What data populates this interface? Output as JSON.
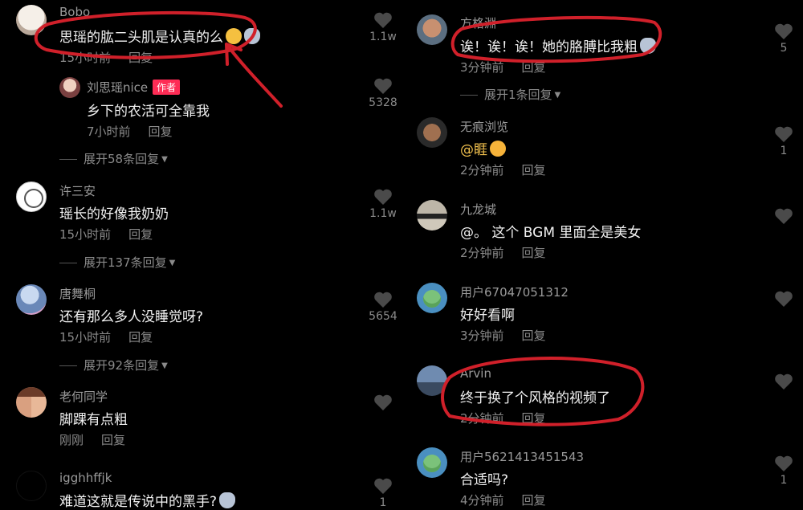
{
  "left": [
    {
      "name": "Bobo",
      "text": "思瑶的肱二头肌是认真的么",
      "time": "15小时前",
      "reply": "回复",
      "likes": "1.1w"
    },
    {
      "name": "刘思瑶nice",
      "tag": "作者",
      "text": "乡下的农活可全靠我",
      "time": "7小时前",
      "reply": "回复",
      "likes": "5328"
    },
    {
      "expand": "展开58条回复"
    },
    {
      "name": "许三安",
      "text": "瑶长的好像我奶奶",
      "time": "15小时前",
      "reply": "回复",
      "likes": "1.1w"
    },
    {
      "expand": "展开137条回复"
    },
    {
      "name": "唐舞桐",
      "text": "还有那么多人没睡觉呀?",
      "time": "15小时前",
      "reply": "回复",
      "likes": "5654"
    },
    {
      "expand": "展开92条回复"
    },
    {
      "name": "老何同学",
      "text": "脚踝有点粗",
      "time": "刚刚",
      "reply": "回复",
      "likes": ""
    },
    {
      "name": "igghhffjk",
      "text": "难道这就是传说中的黑手?",
      "time": "",
      "reply": "",
      "likes": "1"
    }
  ],
  "right": [
    {
      "name": "方格淵",
      "text": "诶！诶！诶！她的胳膊比我粗",
      "time": "3分钟前",
      "reply": "回复",
      "likes": "5"
    },
    {
      "expand": "展开1条回复"
    },
    {
      "name": "无痕浏览",
      "text": "@睚",
      "time": "2分钟前",
      "reply": "回复",
      "likes": "1"
    },
    {
      "name": "九龙城",
      "text": "@。 这个 BGM 里面全是美女",
      "time": "2分钟前",
      "reply": "回复",
      "likes": ""
    },
    {
      "name": "用户67047051312",
      "text": "好好看啊",
      "time": "3分钟前",
      "reply": "回复",
      "likes": ""
    },
    {
      "name": "Arvin",
      "text": "终于换了个风格的视频了",
      "time": "2分钟前",
      "reply": "回复",
      "likes": ""
    },
    {
      "name": "用户5621413451543",
      "text": "合适吗?",
      "time": "4分钟前",
      "reply": "回复",
      "likes": "1"
    }
  ],
  "colors": {
    "annotation": "#d0202a",
    "author_tag": "#fe2c55",
    "background": "#000000"
  }
}
